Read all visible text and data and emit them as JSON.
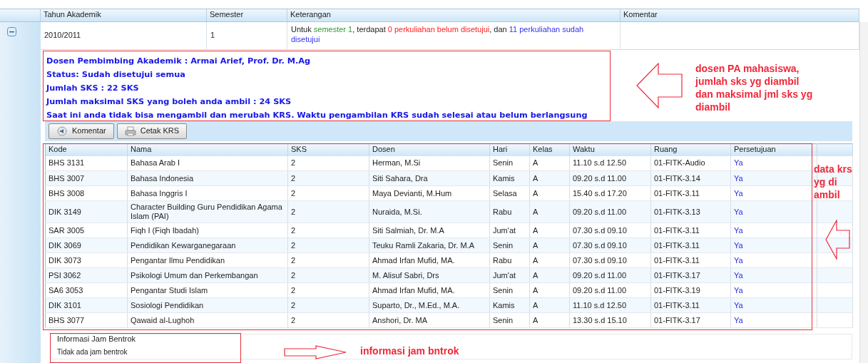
{
  "grid": {
    "columns": [
      "Tahun Akademik",
      "Semester",
      "Keterangan",
      "Komentar"
    ],
    "rows": [
      {
        "expanded": true,
        "tahun": "2010/2011",
        "semester": "1",
        "keterangan": [
          {
            "text": "Untuk "
          },
          {
            "text": "semester 1",
            "color": "#2e9a2e"
          },
          {
            "text": ", terdapat "
          },
          {
            "text": "0 perkuliahan belum disetujui",
            "color": "#ff2020"
          },
          {
            "text": ", dan "
          },
          {
            "text": "11 perkuliahan sudah disetujui",
            "color": "#3333ee"
          }
        ]
      }
    ]
  },
  "info_lines": [
    "Dosen Pembimbing Akademik : Armai Arief, Prof. Dr. M.Ag",
    "Status: Sudah disetujui semua",
    "Jumlah SKS : 22 SKS",
    "Jumlah maksimal SKS yang boleh anda ambil : 24 SKS",
    "Saat ini anda tidak bisa mengambil dan merubah KRS. Waktu pengambilan KRS sudah selesai atau belum berlangsung"
  ],
  "toolbar": [
    {
      "label": "Komentar",
      "kind": "comment"
    },
    {
      "label": "Cetak KRS",
      "kind": "print"
    }
  ],
  "courses": {
    "columns": [
      "Kode",
      "Nama",
      "SKS",
      "Dosen",
      "Hari",
      "Kelas",
      "Waktu",
      "Ruang",
      "Persetujuan"
    ],
    "rows": [
      [
        "BHS 3131",
        "Bahasa Arab I",
        "2",
        "Herman, M.Si",
        "Senin",
        "A",
        "11.10 s.d 12.50",
        "01-FITK-Audio",
        "Ya"
      ],
      [
        "BHS 3007",
        "Bahasa Indonesia",
        "2",
        "Siti Sahara, Dra",
        "Kamis",
        "A",
        "09.20 s.d 11.00",
        "01-FITK-3.14",
        "Ya"
      ],
      [
        "BHS 3008",
        "Bahasa Inggris I",
        "2",
        "Maya Devianti, M.Hum",
        "Selasa",
        "A",
        "15.40 s.d 17.20",
        "01-FITK-3.11",
        "Ya"
      ],
      [
        "DIK 3149",
        "Character Building Guru Pendidikan Agama Islam (PAI)",
        "2",
        "Nuraida, M.Si.",
        "Rabu",
        "A",
        "09.20 s.d 11.00",
        "01-FITK-3.13",
        "Ya"
      ],
      [
        "SAR 3005",
        "Fiqh I (Fiqh Ibadah)",
        "2",
        "Siti Salmiah, Dr. M.A",
        "Jum'at",
        "A",
        "07.30 s.d 09.10",
        "01-FITK-3.11",
        "Ya"
      ],
      [
        "DIK 3069",
        "Pendidikan Kewarganegaraan",
        "2",
        "Teuku Ramli Zakaria, Dr. M.A",
        "Senin",
        "A",
        "07.30 s.d 09.10",
        "01-FITK-3.11",
        "Ya"
      ],
      [
        "DIK 3073",
        "Pengantar Ilmu Pendidikan",
        "2",
        "Ahmad Irfan Mufid, MA.",
        "Rabu",
        "A",
        "07.30 s.d 09.10",
        "01-FITK-3.11",
        "Ya"
      ],
      [
        "PSI 3062",
        "Psikologi Umum dan Perkembangan",
        "2",
        "M. Alisuf Sabri, Drs",
        "Jum'at",
        "A",
        "09.20 s.d 11.00",
        "01-FITK-3.17",
        "Ya"
      ],
      [
        "SA6 3053",
        "Pengantar Studi Islam",
        "2",
        "Ahmad Irfan Mufid, MA.",
        "Senin",
        "A",
        "09.20 s.d 11.00",
        "01-FITK-3.19",
        "Ya"
      ],
      [
        "DIK 3101",
        "Sosiologi Pendidikan",
        "2",
        "Suparto, Dr., M.Ed., M.A.",
        "Kamis",
        "A",
        "11.10 s.d 12.50",
        "01-FITK-3.11",
        "Ya"
      ],
      [
        "BHS 3077",
        "Qawaid al-Lughoh",
        "2",
        "Anshori, Dr. MA",
        "Senin",
        "A",
        "13.30 s.d 15.10",
        "01-FITK-3.17",
        "Ya"
      ]
    ]
  },
  "clash_info": {
    "legend": "Informasi Jam Bentrok",
    "text": "Tidak ada jam bentrok"
  },
  "annotations": [
    {
      "kind": "left",
      "text": "dosen PA mahasiswa, jumlah sks yg diambil dan maksimal jml sks yg diambil"
    },
    {
      "kind": "left-small",
      "text": "data krs yg di ambil"
    },
    {
      "kind": "right",
      "text": "informasi jam bntrok"
    }
  ]
}
